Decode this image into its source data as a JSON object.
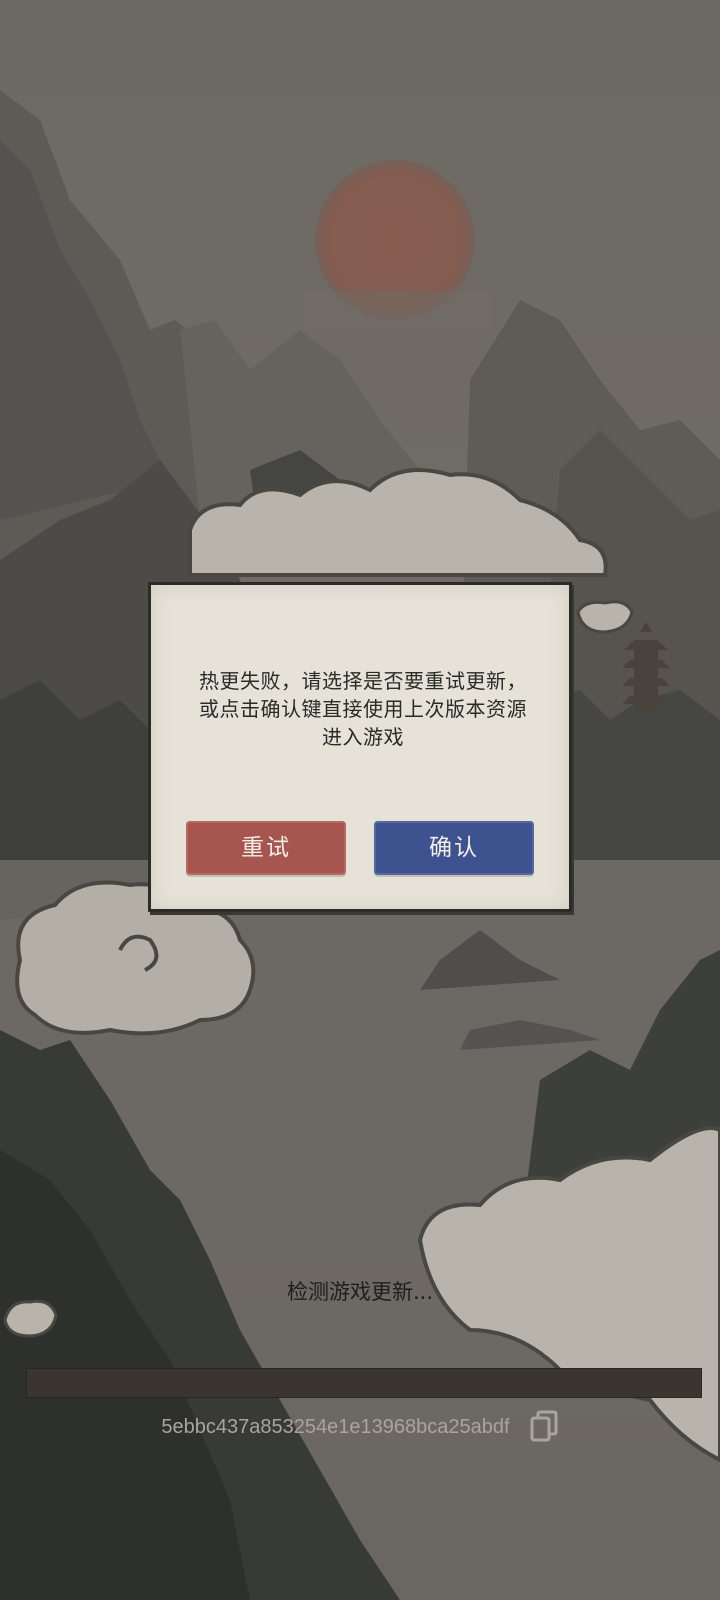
{
  "dialog": {
    "message_lines": [
      "热更失败，请选择是否要重试更新，",
      "或点击确认键直接使用上次版本资源",
      "进入游戏"
    ],
    "retry_label": "重试",
    "confirm_label": "确认"
  },
  "loading": {
    "status_text": "检测游戏更新...",
    "progress": 0,
    "hash": "5ebbc437a853254e1e13968bca25abdf"
  },
  "icons": {
    "copy": "copy-icon"
  },
  "colors": {
    "retry_button": "#a6554f",
    "confirm_button": "#3e5290",
    "dialog_bg": "#e6e2d8",
    "sun": "#8e5a4c"
  }
}
